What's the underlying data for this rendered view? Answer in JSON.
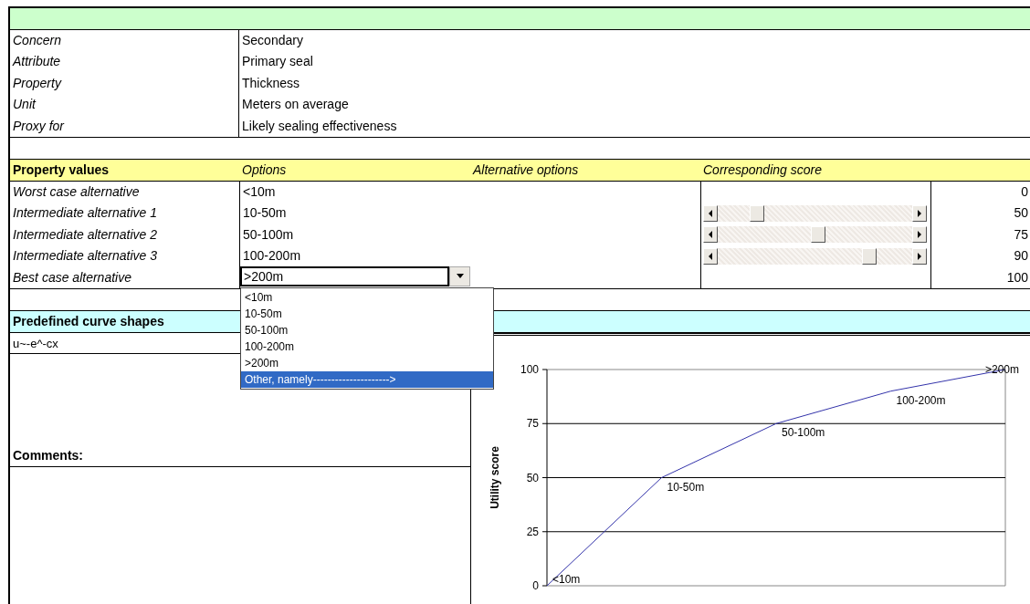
{
  "info": [
    {
      "label": "Concern",
      "value": "Secondary"
    },
    {
      "label": "Attribute",
      "value": "Primary seal"
    },
    {
      "label": "Property",
      "value": "Thickness"
    },
    {
      "label": "Unit",
      "value": "Meters on average"
    },
    {
      "label": "Proxy for",
      "value": "Likely sealing effectiveness"
    }
  ],
  "values_header": {
    "title": "Property values",
    "options": "Options",
    "alternative_options": "Alternative options",
    "score": "Corresponding score"
  },
  "alternatives": [
    {
      "label": "Worst case alternative",
      "option": "<10m",
      "score": "0"
    },
    {
      "label": "Intermediate alternative 1",
      "option": "10-50m",
      "score": "50",
      "slider": {
        "level": 0.18
      }
    },
    {
      "label": "Intermediate alternative 2",
      "option": "50-100m",
      "score": "75",
      "slider": {
        "level": 0.52
      }
    },
    {
      "label": "Intermediate alternative 3",
      "option": "100-200m",
      "score": "90",
      "slider": {
        "level": 0.8
      }
    },
    {
      "label": "Best case alternative",
      "option": ">200m",
      "score": "100",
      "dropdown": {
        "expanded": true,
        "items": [
          {
            "label": "<10m",
            "selected": false
          },
          {
            "label": "10-50m",
            "selected": false
          },
          {
            "label": "50-100m",
            "selected": false
          },
          {
            "label": "100-200m",
            "selected": false
          },
          {
            "label": ">200m",
            "selected": false
          },
          {
            "label": "Other, namely--------------------->",
            "selected": true
          }
        ]
      }
    }
  ],
  "curves": {
    "title": "Predefined curve shapes",
    "formula": "u~-e^-cx"
  },
  "comments": {
    "label": "Comments:"
  },
  "chart_data": {
    "type": "line",
    "ylabel": "Utility score",
    "categories": [
      "<10m",
      "10-50m",
      "50-100m",
      "100-200m",
      ">200m"
    ],
    "series": [
      {
        "color": "#3333aa",
        "values": [
          0,
          50,
          75,
          90,
          100
        ]
      }
    ],
    "ylim": [
      0,
      100
    ],
    "yticks": [
      0,
      25,
      50,
      75,
      100
    ],
    "grid": true
  }
}
